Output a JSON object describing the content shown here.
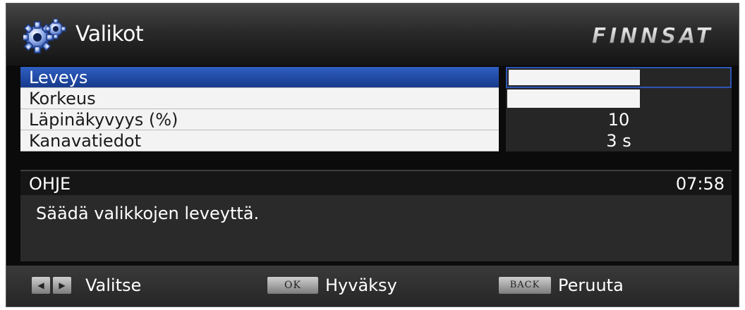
{
  "header": {
    "title": "Valikot",
    "brand": "FINNSAT",
    "icon": "gear-icon"
  },
  "menu": {
    "items": [
      {
        "label": "Leveys",
        "value": "",
        "bar_fraction": 0.6,
        "selected": true
      },
      {
        "label": "Korkeus",
        "value": "",
        "bar_fraction": 0.6,
        "selected": false
      },
      {
        "label": "Läpinäkyvyys (%)",
        "value": "10",
        "selected": false
      },
      {
        "label": "Kanavatiedot",
        "value": "3 s",
        "selected": false
      }
    ]
  },
  "help": {
    "title": "OHJE",
    "time": "07:58",
    "text": "Säädä valikkojen leveyttä."
  },
  "footer": {
    "select_label": "Valitse",
    "ok_key": "OK",
    "ok_label": "Hyväksy",
    "back_key": "BACK",
    "back_label": "Peruuta"
  },
  "colors": {
    "accent": "#2a55b8",
    "background": "#0b0b0b"
  }
}
